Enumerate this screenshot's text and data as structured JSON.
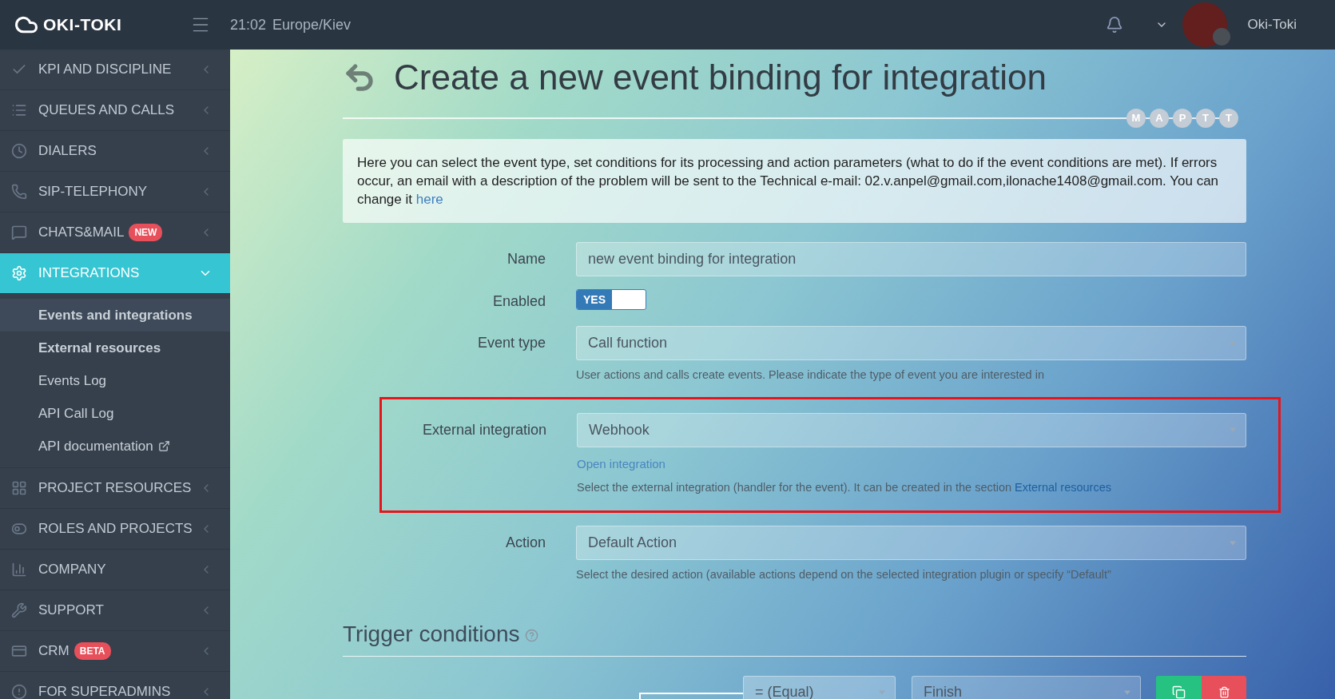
{
  "header": {
    "logo": "OKI-TOKI",
    "time": "21:02",
    "timezone": "Europe/Kiev",
    "user": "Oki-Toki"
  },
  "sidebar": {
    "items": [
      {
        "label": "KPI AND DISCIPLINE",
        "expanded": false,
        "selected": false
      },
      {
        "label": "QUEUES AND CALLS",
        "expanded": false,
        "selected": false
      },
      {
        "label": "DIALERS",
        "expanded": false,
        "selected": false
      },
      {
        "label": "SIP-TELEPHONY",
        "expanded": false,
        "selected": false
      },
      {
        "label": "CHATS&MAIL",
        "badge": "NEW",
        "expanded": false,
        "selected": false
      },
      {
        "label": "INTEGRATIONS",
        "expanded": true,
        "selected": true,
        "children": [
          {
            "label": "Events and integrations",
            "selected": true,
            "bold": true
          },
          {
            "label": "External resources",
            "selected": false,
            "bold": true
          },
          {
            "label": "Events Log",
            "selected": false,
            "bold": false
          },
          {
            "label": "API Call Log",
            "selected": false,
            "bold": false
          },
          {
            "label": "API documentation",
            "selected": false,
            "bold": false,
            "external": true
          }
        ]
      },
      {
        "label": "PROJECT RESOURCES",
        "expanded": false,
        "selected": false
      },
      {
        "label": "ROLES AND PROJECTS",
        "expanded": false,
        "selected": false
      },
      {
        "label": "COMPANY",
        "expanded": false,
        "selected": false
      },
      {
        "label": "SUPPORT",
        "expanded": false,
        "selected": false
      },
      {
        "label": "CRM",
        "badge": "BETA",
        "expanded": false,
        "selected": false
      },
      {
        "label": "FOR SUPERADMINS",
        "expanded": false,
        "selected": false
      }
    ]
  },
  "page": {
    "title": "Create a new event binding for integration",
    "steps": [
      "M",
      "A",
      "P",
      "T",
      "T"
    ],
    "info": {
      "text": "Here you can select the event type, set conditions for its processing and action parameters (what to do if the event conditions are met). If errors occur, an email with a description of the problem will be sent to the Technical e-mail: 02.v.anpel@gmail.com,ilonache1408@gmail.com. You can change it",
      "link": "here"
    }
  },
  "form": {
    "fields": [
      {
        "kind": "text",
        "label": "Name",
        "value": "new event binding for integration",
        "highlighted": false
      },
      {
        "kind": "toggle",
        "label": "Enabled",
        "on": true,
        "on_label": "YES",
        "highlighted": false
      },
      {
        "kind": "select",
        "label": "Event type",
        "value": "Call function",
        "help": "User actions and calls create events. Please indicate the type of event you are interested in",
        "highlighted": false
      },
      {
        "kind": "select",
        "label": "External integration",
        "value": "Webhook",
        "link": "Open integration",
        "help": "Select the external integration (handler for the event). It can be created in the section",
        "help_link": "External resources",
        "highlighted": true
      },
      {
        "kind": "select",
        "label": "Action",
        "value": "Default Action",
        "help": "Select the desired action (available actions depend on the selected integration plugin or specify “Default”",
        "highlighted": false
      }
    ]
  },
  "trigger": {
    "title": "Trigger conditions",
    "operator": "= (Equal)",
    "value": "Finish"
  }
}
